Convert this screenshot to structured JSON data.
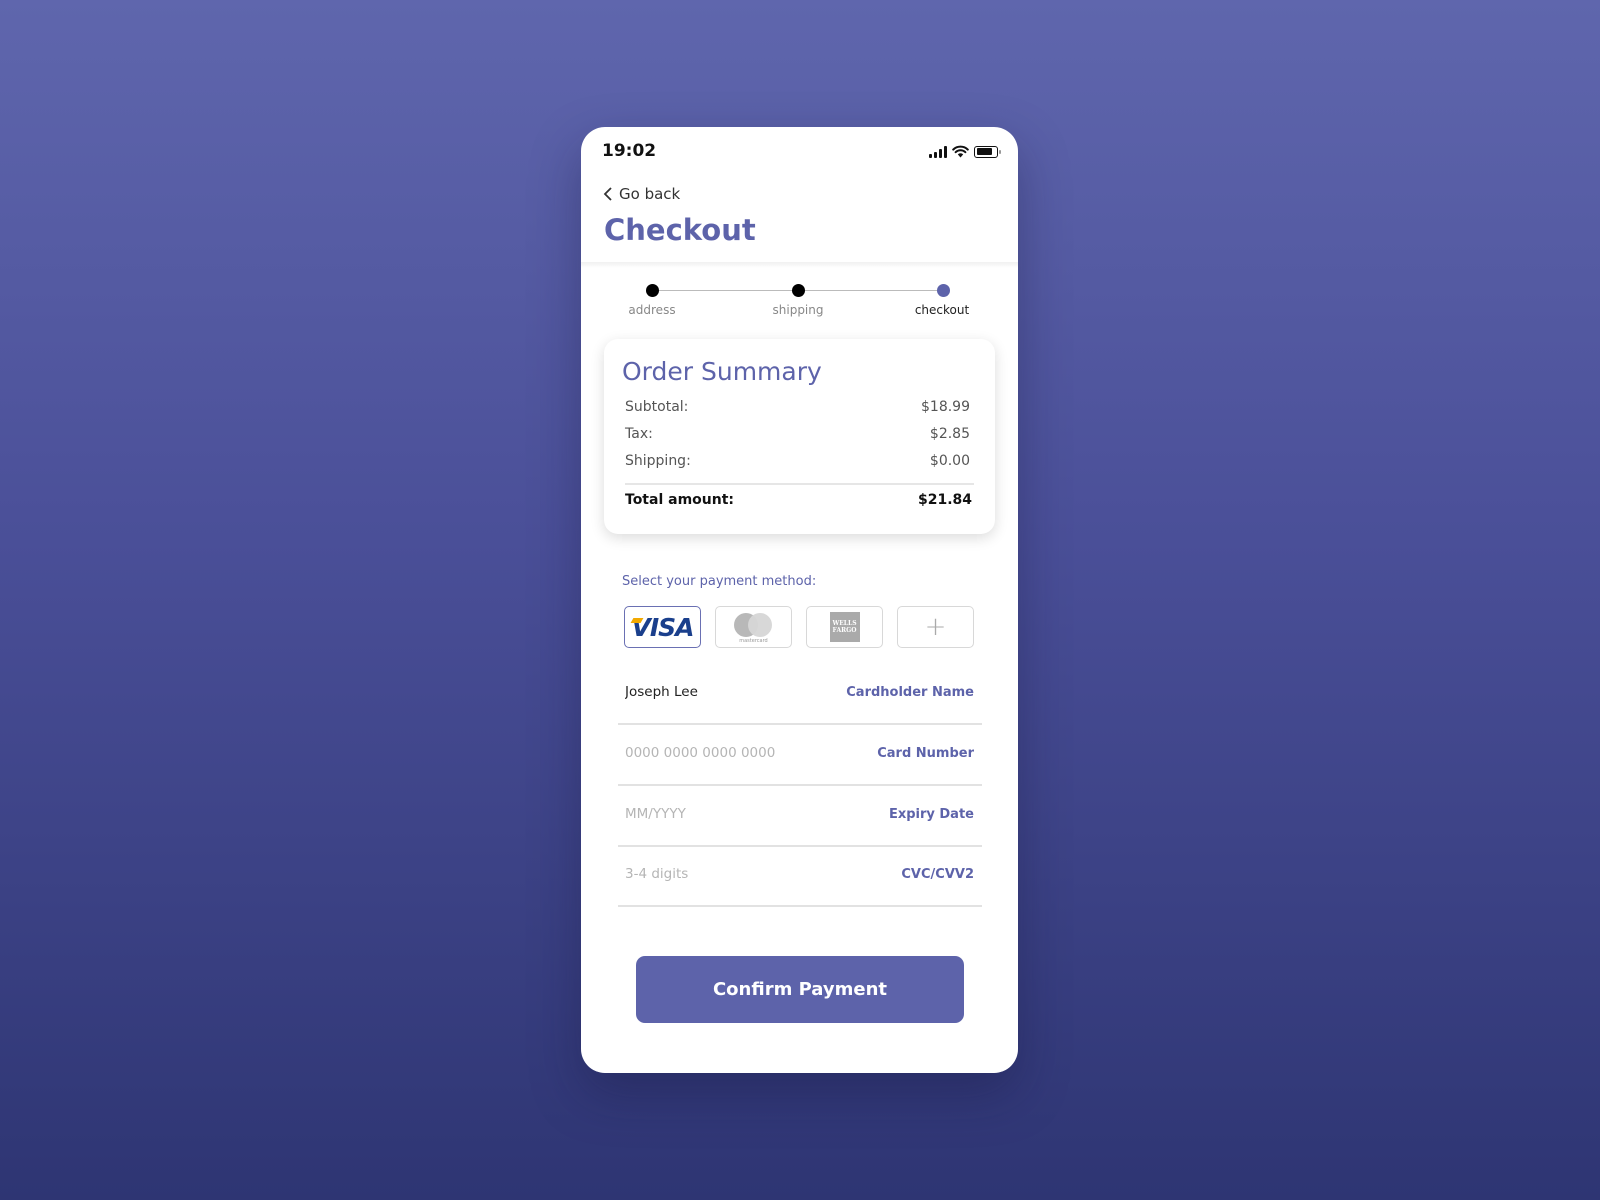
{
  "status_bar": {
    "time": "19:02",
    "icons": [
      "cellular-signal-icon",
      "wifi-icon",
      "battery-icon"
    ],
    "battery_level": 0.8
  },
  "nav": {
    "back_label": "Go back",
    "back_icon": "chevron-left-icon"
  },
  "page": {
    "title": "Checkout"
  },
  "stepper": {
    "steps": [
      {
        "label": "address",
        "state": "completed"
      },
      {
        "label": "shipping",
        "state": "completed"
      },
      {
        "label": "checkout",
        "state": "active"
      }
    ]
  },
  "order_summary": {
    "title": "Order Summary",
    "rows": [
      {
        "label": "Subtotal:",
        "value": "$18.99"
      },
      {
        "label": "Tax:",
        "value": "$2.85"
      },
      {
        "label": "Shipping:",
        "value": "$0.00"
      }
    ],
    "total": {
      "label": "Total amount:",
      "value": "$21.84"
    }
  },
  "payment": {
    "prompt": "Select your payment method:",
    "methods": [
      {
        "name": "visa",
        "label": "VISA",
        "selected": true
      },
      {
        "name": "mastercard",
        "label": "mastercard",
        "selected": false
      },
      {
        "name": "wells-fargo",
        "label": "WELLS FARGO",
        "selected": false
      },
      {
        "name": "add",
        "label": "+",
        "selected": false
      }
    ]
  },
  "form": {
    "fields": [
      {
        "label": "Cardholder Name",
        "value": "Joseph Lee",
        "placeholder": ""
      },
      {
        "label": "Card Number",
        "value": "",
        "placeholder": "0000 0000 0000 0000"
      },
      {
        "label": "Expiry Date",
        "value": "",
        "placeholder": "MM/YYYY"
      },
      {
        "label": "CVC/CVV2",
        "value": "",
        "placeholder": "3-4 digits"
      }
    ]
  },
  "actions": {
    "confirm_label": "Confirm Payment"
  },
  "colors": {
    "accent": "#5d63aa",
    "background_top": "#5f66ad",
    "background_bottom": "#2e3573"
  }
}
